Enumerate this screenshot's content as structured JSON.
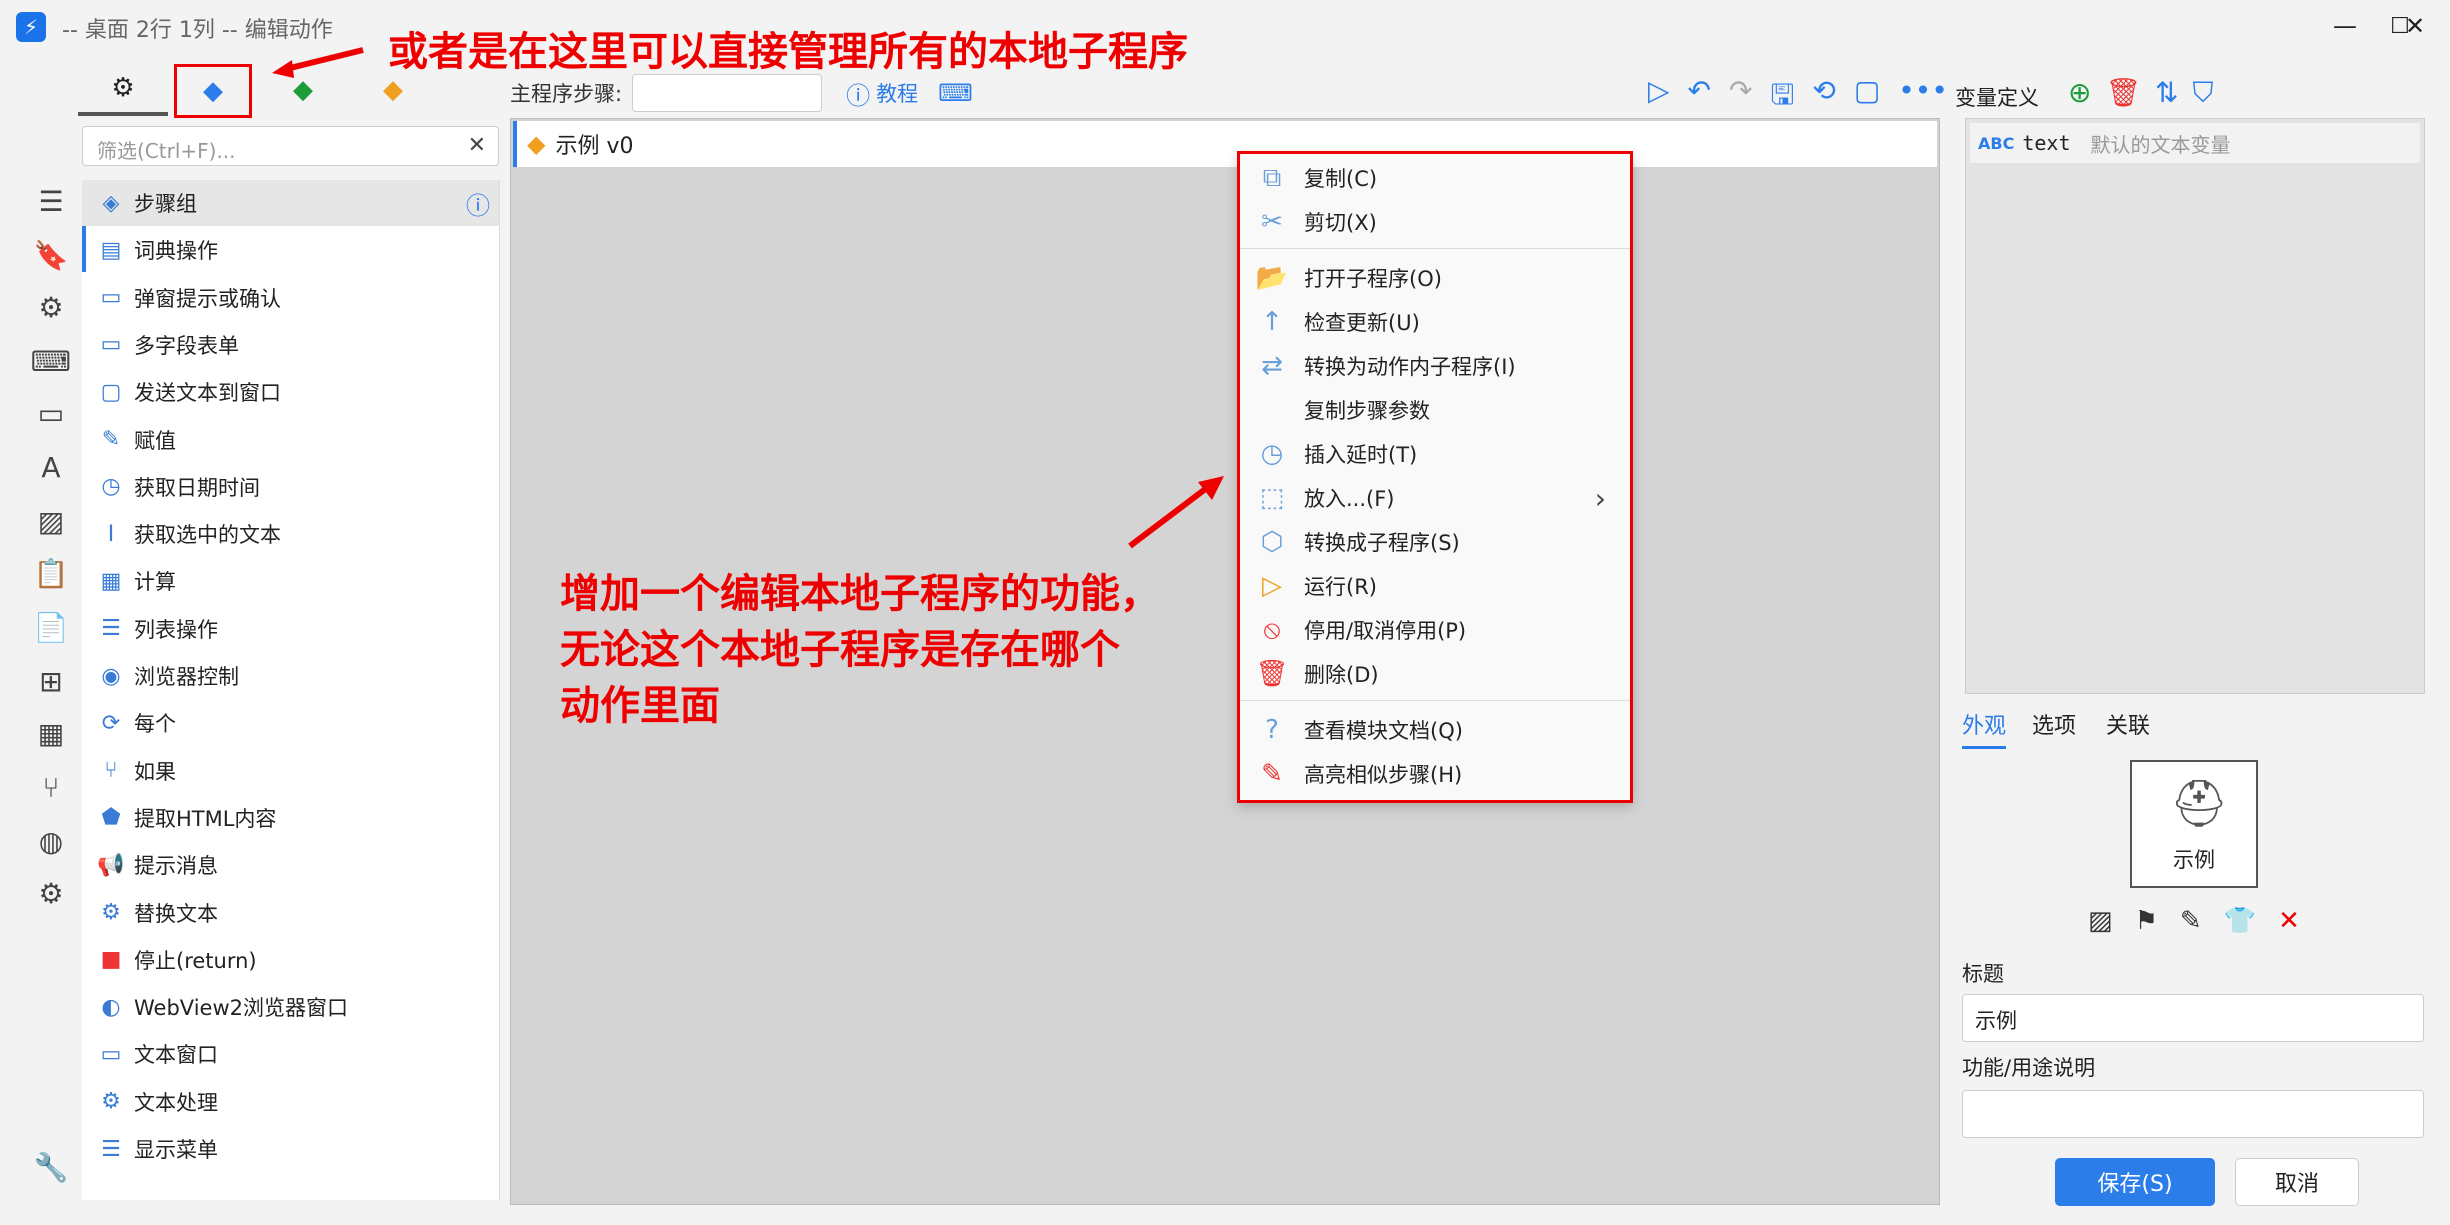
{
  "window": {
    "title": "-- 桌面 2行 1列 -- 编辑动作",
    "minimize": "—",
    "maximize": "☐",
    "close": "✕"
  },
  "annotations": {
    "top_note": "或者是在这里可以直接管理所有的本地子程序",
    "middle_note_1": "增加一个编辑本地子程序的功能，",
    "middle_note_2": "无论这个本地子程序是存在哪个",
    "middle_note_3": "动作里面"
  },
  "toolbar": {
    "main_steps_label": "主程序步骤:",
    "main_steps_value": "",
    "tutorial": "教程"
  },
  "filter": {
    "placeholder": "筛选(Ctrl+F)..."
  },
  "step_list": [
    {
      "label": "步骤组",
      "icon": "layers-icon"
    },
    {
      "label": "词典操作",
      "icon": "book-icon"
    },
    {
      "label": "弹窗提示或确认",
      "icon": "window-icon"
    },
    {
      "label": "多字段表单",
      "icon": "form-icon"
    },
    {
      "label": "发送文本到窗口",
      "icon": "message-icon"
    },
    {
      "label": "赋值",
      "icon": "edit-icon"
    },
    {
      "label": "获取日期时间",
      "icon": "clock-icon"
    },
    {
      "label": "获取选中的文本",
      "icon": "text-cursor-icon"
    },
    {
      "label": "计算",
      "icon": "calculator-icon"
    },
    {
      "label": "列表操作",
      "icon": "list-icon"
    },
    {
      "label": "浏览器控制",
      "icon": "browser-icon"
    },
    {
      "label": "每个",
      "icon": "loop-icon"
    },
    {
      "label": "如果",
      "icon": "branch-icon"
    },
    {
      "label": "提取HTML内容",
      "icon": "html-icon"
    },
    {
      "label": "提示消息",
      "icon": "megaphone-icon"
    },
    {
      "label": "替换文本",
      "icon": "gear-icon"
    },
    {
      "label": "停止(return)",
      "icon": "stop-icon"
    },
    {
      "label": "WebView2浏览器窗口",
      "icon": "edge-icon"
    },
    {
      "label": "文本窗口",
      "icon": "window-icon"
    },
    {
      "label": "文本处理",
      "icon": "gear-icon"
    },
    {
      "label": "显示菜单",
      "icon": "menu-icon"
    }
  ],
  "canvas": {
    "subprogram_label": "示例 v0"
  },
  "context_menu": [
    {
      "label": "复制(C)",
      "icon": "copy-icon"
    },
    {
      "label": "剪切(X)",
      "icon": "scissors-icon"
    },
    {
      "label": "打开子程序(O)",
      "icon": "folder-open-icon"
    },
    {
      "label": "检查更新(U)",
      "icon": "arrow-up-icon"
    },
    {
      "label": "转换为动作内子程序(I)",
      "icon": "swap-icon"
    },
    {
      "label": "复制步骤参数",
      "icon": ""
    },
    {
      "label": "插入延时(T)",
      "icon": "clock-icon"
    },
    {
      "label": "放入...(F)",
      "icon": "frame-icon"
    },
    {
      "label": "转换成子程序(S)",
      "icon": "cube-icon"
    },
    {
      "label": "运行(R)",
      "icon": "play-icon"
    },
    {
      "label": "停用/取消停用(P)",
      "icon": "ban-icon"
    },
    {
      "label": "删除(D)",
      "icon": "trash-icon"
    },
    {
      "label": "查看模块文档(Q)",
      "icon": "help-icon"
    },
    {
      "label": "高亮相似步骤(H)",
      "icon": "highlighter-icon"
    }
  ],
  "right_panel": {
    "variables_title": "变量定义",
    "variable": {
      "type": "ABC",
      "name": "text",
      "description": "默认的文本变量"
    },
    "tabs": [
      "外观",
      "选项",
      "关联"
    ],
    "preview_label": "示例",
    "title_label": "标题",
    "title_value": "示例",
    "desc_label": "功能/用途说明",
    "desc_value": "",
    "save": "保存(S)",
    "cancel": "取消"
  },
  "colors": {
    "accent": "#2b7de9",
    "annotation": "#ee0000",
    "green": "#1e9c3a",
    "orange": "#f0a020"
  }
}
